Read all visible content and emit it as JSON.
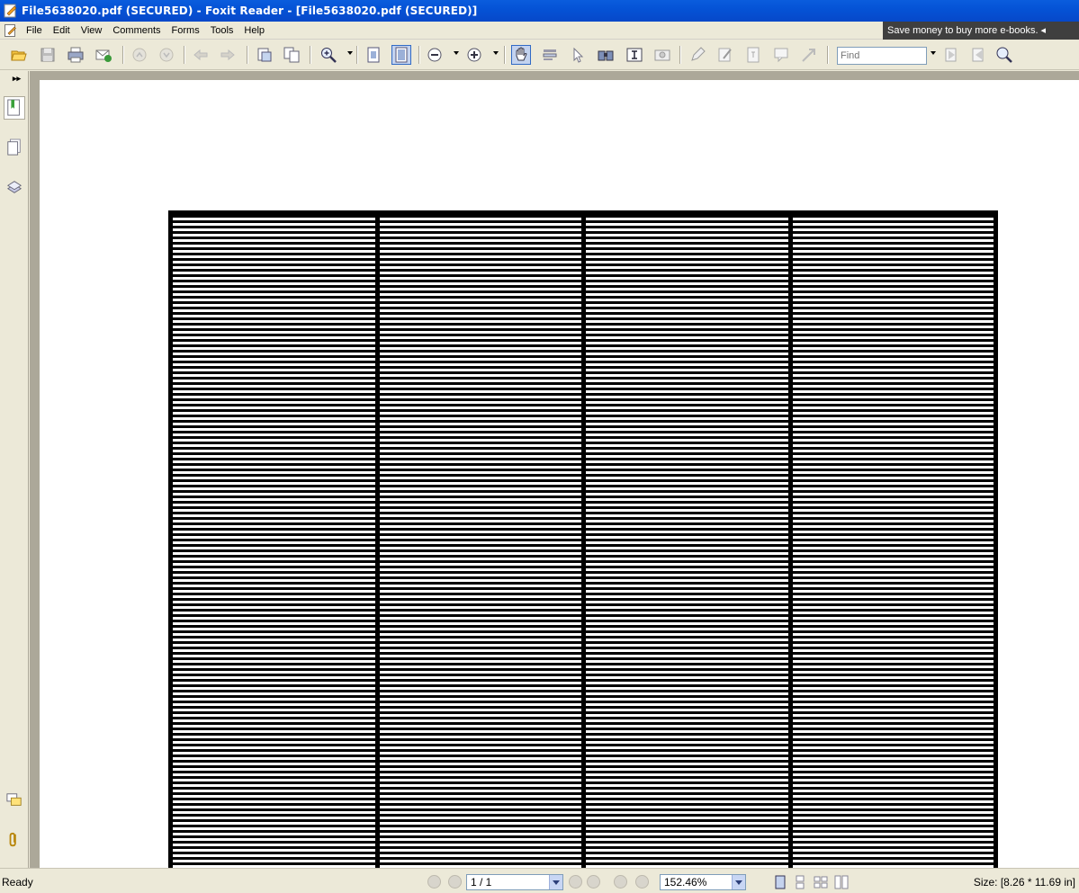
{
  "window": {
    "title": "File5638020.pdf (SECURED) - Foxit Reader - [File5638020.pdf (SECURED)]"
  },
  "menu": {
    "items": [
      "File",
      "Edit",
      "View",
      "Comments",
      "Forms",
      "Tools",
      "Help"
    ]
  },
  "ad": {
    "text": "Save money to buy more e-books."
  },
  "toolbar": {
    "find_placeholder": "Find",
    "icons": [
      "open-icon",
      "save-icon",
      "print-icon",
      "email-icon",
      "first-page-icon",
      "last-page-icon",
      "back-icon",
      "forward-icon",
      "properties-icon",
      "copy-icon",
      "zoom-icon",
      "actual-size-icon",
      "fit-page-icon",
      "zoom-out-icon",
      "zoom-in-icon",
      "hand-tool-icon",
      "select-text-icon",
      "select-icon",
      "snapshot-icon",
      "typewriter-icon",
      "image-icon",
      "note-icon",
      "pencil-icon",
      "text-box-icon",
      "comment-icon",
      "arrow-icon",
      "find-prev-icon",
      "find-next-icon",
      "search-icon"
    ]
  },
  "left_panel": {
    "icons": [
      "bookmarks-icon",
      "pages-icon",
      "layers-icon",
      "comments-icon",
      "attachments-icon"
    ]
  },
  "document": {
    "table_columns": 4,
    "table_rows": 121
  },
  "status": {
    "ready": "Ready",
    "page_display": "1 / 1",
    "zoom": "152.46%",
    "size": "Size: [8.26 * 11.69 in]"
  }
}
